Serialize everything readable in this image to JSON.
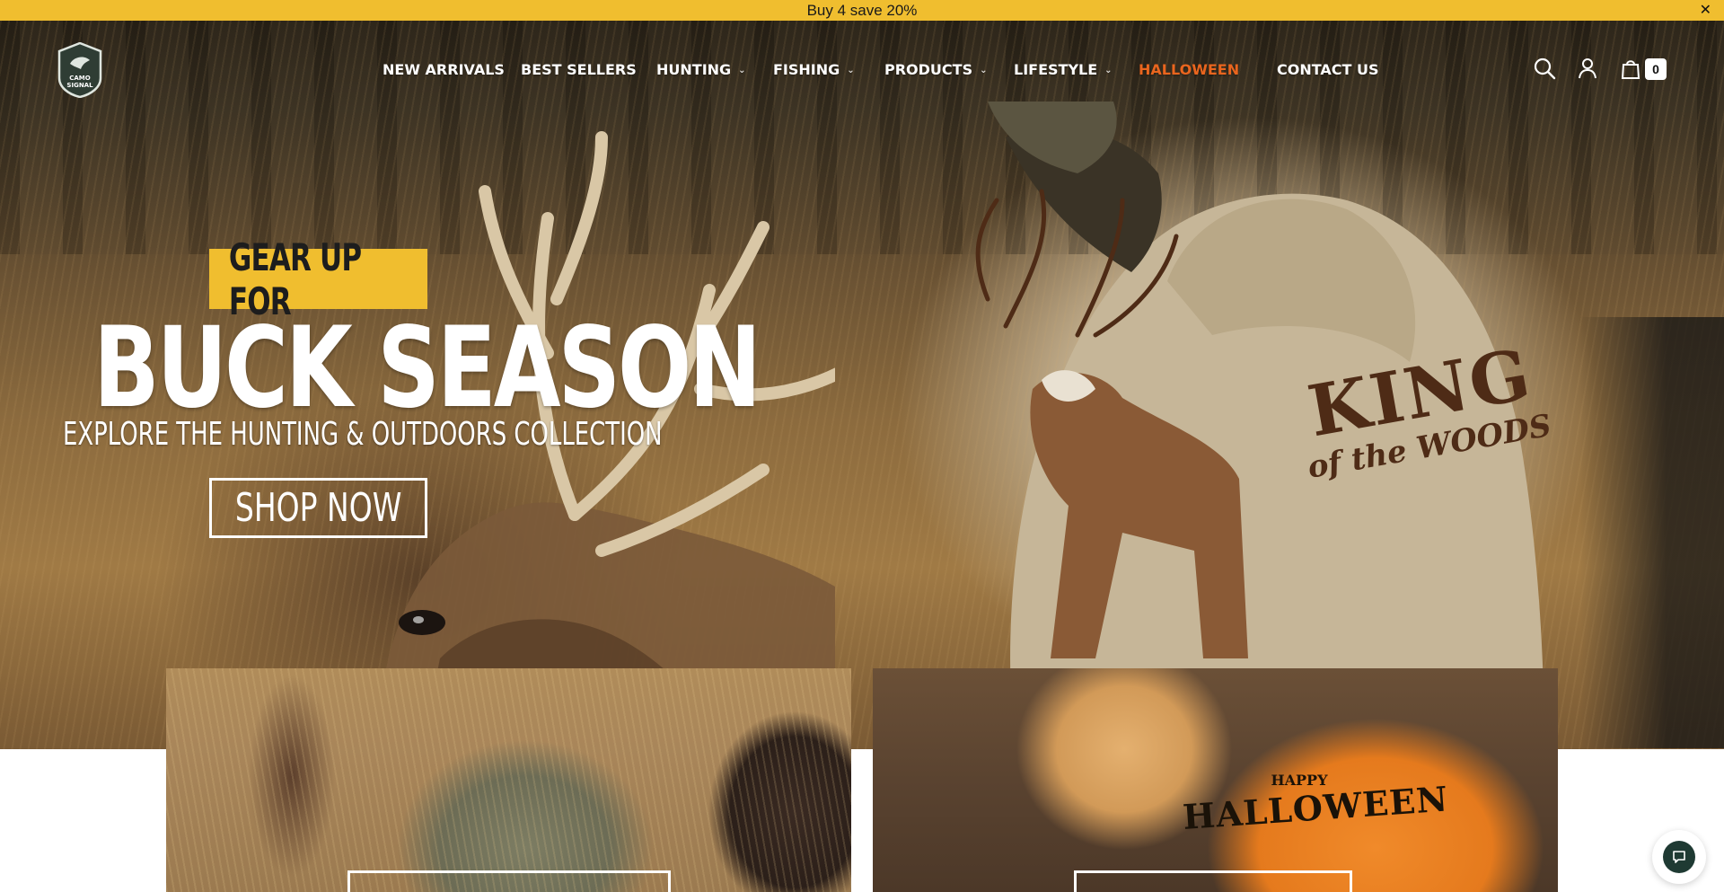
{
  "announcement": {
    "text": "Buy 4 save 20%",
    "close_icon": "close-icon"
  },
  "brand": {
    "logo_text_1": "CAMO",
    "logo_text_2": "SIGNAL"
  },
  "nav": {
    "items": [
      {
        "label": "NEW ARRIVALS",
        "has_dropdown": false
      },
      {
        "label": "BEST SELLERS",
        "has_dropdown": false
      },
      {
        "label": "HUNTING",
        "has_dropdown": true
      },
      {
        "label": "FISHING",
        "has_dropdown": true
      },
      {
        "label": "PRODUCTS",
        "has_dropdown": true
      },
      {
        "label": "LIFESTYLE",
        "has_dropdown": true
      },
      {
        "label": "HALLOWEEN",
        "has_dropdown": false
      },
      {
        "label": "CONTACT US",
        "has_dropdown": false
      }
    ],
    "cart_count": "0",
    "icons": [
      "search-icon",
      "account-icon",
      "cart-icon"
    ]
  },
  "hero": {
    "eyebrow": "GEAR UP FOR",
    "headline": "BUCK SEASON",
    "subheadline": "EXPLORE THE HUNTING & OUTDOORS COLLECTION",
    "cta": "SHOP NOW",
    "hoodie_print_line1": "KING",
    "hoodie_print_line2": "of the WOODS"
  },
  "cards": {
    "right_print_small": "HAPPY",
    "right_print_big": "HALLOWEEN"
  },
  "colors": {
    "announcement_bg": "#f0be2f",
    "accent_yellow": "#f0be2f",
    "halloween_accent": "#e9651e",
    "chat_bg": "#1f3a33"
  }
}
